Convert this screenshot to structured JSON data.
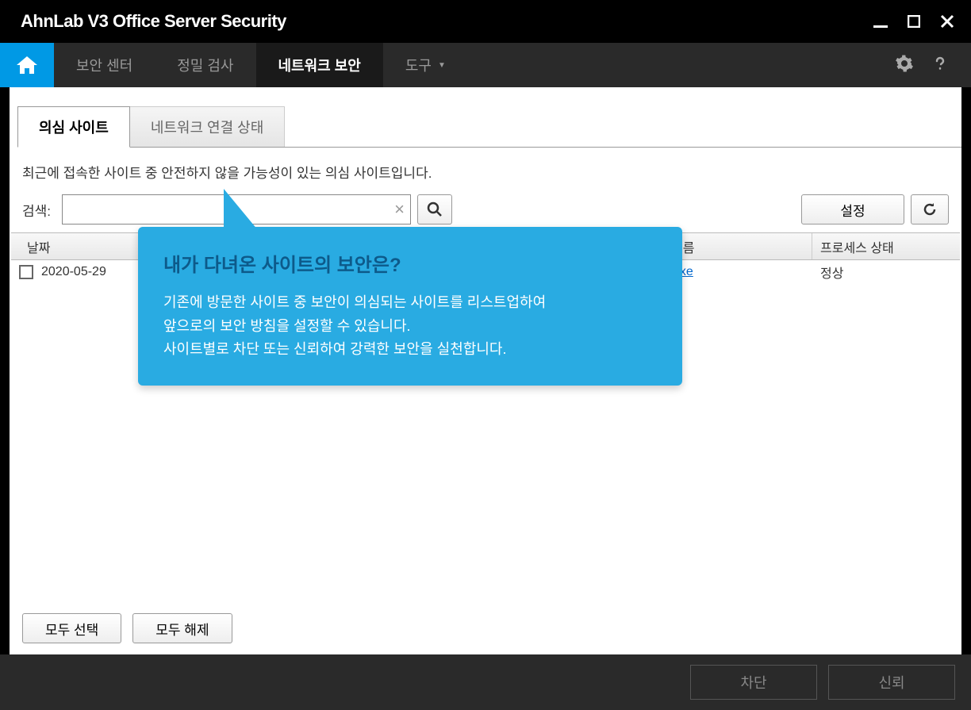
{
  "window": {
    "title": "AhnLab V3 Office Server Security"
  },
  "nav": {
    "items": [
      {
        "label": "보안 센터",
        "active": false
      },
      {
        "label": "정밀 검사",
        "active": false
      },
      {
        "label": "네트워크 보안",
        "active": true
      },
      {
        "label": "도구",
        "active": false,
        "hasDropdown": true
      }
    ]
  },
  "tabs": [
    {
      "label": "의심 사이트",
      "active": true
    },
    {
      "label": "네트워크 연결 상태",
      "active": false
    }
  ],
  "description": "최근에 접속한 사이트 중 안전하지 않을 가능성이 있는 의심 사이트입니다.",
  "search": {
    "label": "검색:",
    "value": ""
  },
  "buttons": {
    "settings": "설정",
    "selectAll": "모두 선택",
    "deselectAll": "모두 해제",
    "block": "차단",
    "trust": "신뢰"
  },
  "table": {
    "headers": {
      "date": "날짜",
      "url": "",
      "name": "이름",
      "status": "프로세스 상태"
    },
    "rows": [
      {
        "date": "2020-05-29",
        "name": "exe",
        "status": "정상"
      }
    ]
  },
  "callout": {
    "title": "내가 다녀온 사이트의 보안은?",
    "line1": "기존에 방문한 사이트 중 보안이 의심되는 사이트를 리스트업하여",
    "line2": "앞으로의 보안 방침을 설정할 수 있습니다.",
    "line3": "사이트별로 차단 또는 신뢰하여 강력한 보안을 실천합니다."
  }
}
